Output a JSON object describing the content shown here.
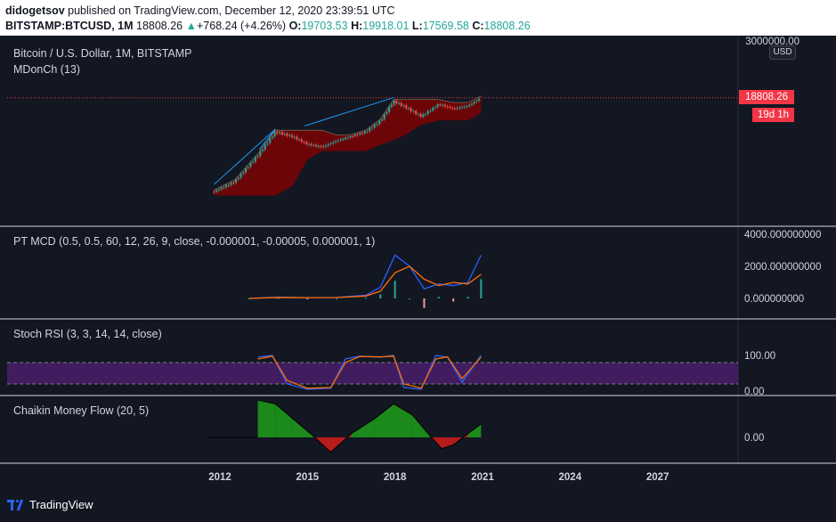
{
  "header": {
    "author": "didogetsov",
    "published_text": "published on TradingView.com, December 12, 2020 23:39:51 UTC",
    "symbol": "BITSTAMP:BTCUSD, 1M",
    "price": "18808.26",
    "change": "+768.24 (+4.26%)",
    "open_label": "O:",
    "open_value": "19703.53",
    "high_label": "H:",
    "high_value": "19918.01",
    "low_label": "L:",
    "low_value": "17569.58",
    "close_label": "C:",
    "close_value": "18808.26"
  },
  "panes": {
    "price": {
      "title": "Bitcoin / U.S. Dollar, 1M, BITSTAMP",
      "indicator": "MDonCh (13)",
      "axis_top_label": "3000000.00",
      "currency_button": "USD",
      "last_price": "18808.26",
      "countdown": "19d 1h"
    },
    "macd": {
      "title": "PT MCD (0.5, 0.5, 60, 12, 26, 9, close, -0.000001, -0.00005, 0.000001, 1)",
      "ticks": [
        "4000.000000000",
        "2000.000000000",
        "0.000000000"
      ]
    },
    "stoch": {
      "title": "Stoch RSI (3, 3, 14, 14, close)",
      "ticks": [
        "100.00",
        "0.00"
      ]
    },
    "cmf": {
      "title": "Chaikin Money Flow (20, 5)",
      "ticks": [
        "0.00"
      ]
    }
  },
  "time_axis": [
    "2012",
    "2015",
    "2018",
    "2021",
    "2024",
    "2027"
  ],
  "footer": {
    "brand": "TradingView"
  },
  "colors": {
    "background": "#131722",
    "up": "#26a69a",
    "down": "#ef5350",
    "price_tag": "#f23645",
    "macd_line": "#2962ff",
    "signal_line": "#ff6d00",
    "stoch_band": "#4a1f6b",
    "cmf_positive": "#1b8a1b",
    "cmf_negative": "#b71c1c"
  },
  "chart_data": [
    {
      "type": "line",
      "title": "Bitcoin / U.S. Dollar, 1M, BITSTAMP",
      "x": [
        2011.8,
        2012.5,
        2013.3,
        2013.9,
        2014.5,
        2015.0,
        2015.5,
        2016.0,
        2016.5,
        2017.0,
        2017.5,
        2017.95,
        2018.3,
        2018.9,
        2019.5,
        2020.0,
        2020.5,
        2020.95
      ],
      "series": [
        {
          "name": "",
          "values": [
            5,
            12,
            120,
            950,
            620,
            320,
            250,
            430,
            650,
            960,
            2500,
            14000,
            9000,
            3700,
            10800,
            7200,
            9200,
            18808
          ]
        }
      ],
      "log_scale": true
    },
    {
      "type": "line",
      "title": "PT MCD (0.5, 0.5, 60, 12, 26, 9, close, -0.000001, -0.00005, 0.000001, 1)",
      "x": [
        2013.0,
        2014.0,
        2015.0,
        2016.0,
        2017.0,
        2017.5,
        2018.0,
        2018.5,
        2019.0,
        2019.5,
        2020.0,
        2020.5,
        2020.95
      ],
      "series": [
        {
          "name": "",
          "values": [
            0,
            80,
            40,
            60,
            200,
            700,
            2700,
            2000,
            600,
            900,
            800,
            1000,
            2700
          ]
        },
        {
          "name": "",
          "values": [
            0,
            60,
            50,
            55,
            150,
            450,
            1600,
            2000,
            1200,
            800,
            1000,
            900,
            1500
          ]
        }
      ],
      "ylim": [
        -800,
        4400
      ]
    },
    {
      "type": "line",
      "title": "Stoch RSI (3, 3, 14, 14, close)",
      "x": [
        2013.3,
        2013.8,
        2014.3,
        2015.0,
        2015.8,
        2016.3,
        2016.8,
        2017.5,
        2017.95,
        2018.3,
        2018.9,
        2019.4,
        2019.8,
        2020.3,
        2020.95
      ],
      "series": [
        {
          "name": "",
          "values": [
            95,
            100,
            20,
            5,
            8,
            90,
            98,
            95,
            100,
            10,
            5,
            100,
            95,
            25,
            100
          ]
        },
        {
          "name": "",
          "values": [
            90,
            98,
            30,
            8,
            10,
            80,
            97,
            96,
            98,
            20,
            8,
            90,
            96,
            35,
            95
          ]
        }
      ],
      "ylim": [
        -10,
        115
      ],
      "band": [
        20,
        80
      ]
    },
    {
      "type": "area",
      "title": "Chaikin Money Flow (20, 5)",
      "x": [
        2013.3,
        2013.9,
        2014.5,
        2015.2,
        2015.8,
        2016.5,
        2017.3,
        2017.95,
        2018.6,
        2019.2,
        2019.6,
        2020.0,
        2020.5,
        2020.95
      ],
      "series": [
        {
          "name": "",
          "values": [
            0.5,
            0.45,
            0.25,
            0.02,
            -0.2,
            0.05,
            0.25,
            0.45,
            0.3,
            0.02,
            -0.15,
            -0.1,
            0.05,
            0.18
          ]
        }
      ],
      "ylim": [
        -0.3,
        0.5
      ]
    }
  ]
}
